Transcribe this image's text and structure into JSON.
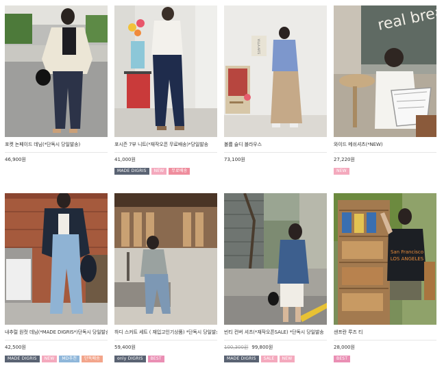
{
  "products": [
    {
      "name": "포켓 논페이드 데님(*단독시 당일발송)",
      "price": "46,900원",
      "badges": []
    },
    {
      "name": "포시즌 7부 니트(*재작오픈 무료배송)*당일발송",
      "price": "41,000원",
      "badges": [
        {
          "text": "MADE DIGRIS",
          "color": "#5a6373"
        },
        {
          "text": "NEW",
          "color": "#f4a9bd"
        },
        {
          "text": "무료배송",
          "color": "#ef8d9d"
        }
      ]
    },
    {
      "name": "볼륨 슬디 블라우스",
      "price": "73,100원",
      "badges": []
    },
    {
      "name": "와이드 메쉬셔츠(*NEW)",
      "price": "27,220원",
      "badges": [
        {
          "text": "NEW",
          "color": "#f4a9bd"
        }
      ]
    },
    {
      "name": "내추럴 원컷 데님(*MADE DIGRIS*)단독시 당일발송",
      "price": "42,500원",
      "badges": [
        {
          "text": "MADE DIGRIS",
          "color": "#5a6373"
        },
        {
          "text": "NEW",
          "color": "#f4a9bd"
        },
        {
          "text": "MD추천",
          "color": "#8fb7da"
        },
        {
          "text": "단독배송",
          "color": "#f3a58b"
        }
      ]
    },
    {
      "name": "하디 스커트 세트 ( 재입고인기상품) *단독시 당일발송",
      "price": "59,400원",
      "badges": [
        {
          "text": "only DIGRIS",
          "color": "#5a6373"
        },
        {
          "text": "BEST",
          "color": "#ea8fb4"
        }
      ]
    },
    {
      "name": "빈티 컨버 셔츠(*재작오픈SALE) *단독시 당일발송",
      "old_price": "100,300원",
      "price": "99,800원",
      "badges": [
        {
          "text": "MADE DIGRIS",
          "color": "#5a6373"
        },
        {
          "text": "SALE",
          "color": "#f4a9bd"
        },
        {
          "text": "NEW",
          "color": "#f4a9bd"
        }
      ]
    },
    {
      "name": "샌프란 루즈 티",
      "price": "28,000원",
      "badges": [
        {
          "text": "BEST",
          "color": "#ea8fb4"
        }
      ]
    }
  ],
  "photo_texts": {
    "cafe_sign": "real bread",
    "poster": "VILLA ARTE",
    "shirt_top": "San Francisco",
    "shirt_bottom": "LOS ANGELES"
  }
}
